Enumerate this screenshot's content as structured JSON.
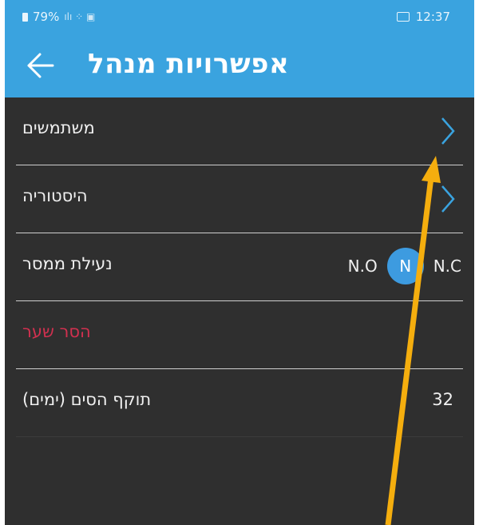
{
  "status_bar": {
    "battery": "79%",
    "time": "12:37"
  },
  "app_bar": {
    "title": "אפשרויות מנהל"
  },
  "rows": {
    "users": "משתמשים",
    "history": "היסטוריה",
    "relay": {
      "label": "נעילת ממסר",
      "option_left": "N.O",
      "knob": "N",
      "option_right": "N.C"
    },
    "remove_gate": "הסר שער",
    "sim_validity": {
      "label": "תוקף הסים (ימים)",
      "value": "32"
    }
  },
  "colors": {
    "accent": "#3aa3df",
    "background": "#2f2f2f",
    "toggle": "#3d9be0",
    "danger_text": "#d1304f",
    "annotation_arrow": "#f5ae0e"
  },
  "icons": [
    "back-arrow-icon",
    "chevron-right-icon",
    "battery-icon",
    "gallery-icon"
  ]
}
